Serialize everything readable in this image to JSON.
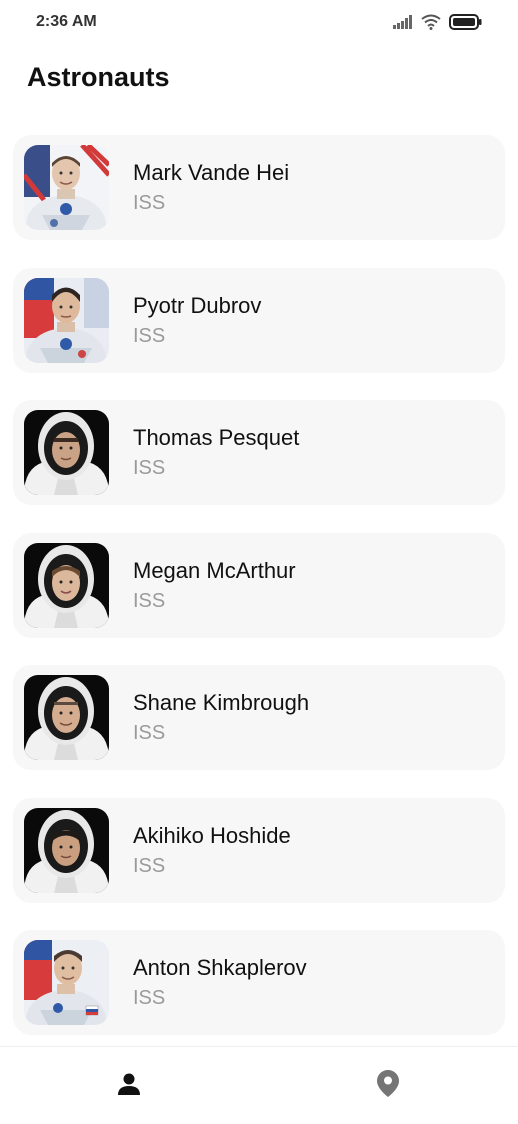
{
  "status_bar": {
    "time": "2:36 AM",
    "icons": [
      "signal-icon",
      "wifi-icon",
      "battery-icon"
    ]
  },
  "page": {
    "title": "Astronauts"
  },
  "astronauts": [
    {
      "name": "Mark Vande Hei",
      "craft": "ISS",
      "portrait": "soyuz-suit-us-flag"
    },
    {
      "name": "Pyotr Dubrov",
      "craft": "ISS",
      "portrait": "soyuz-suit-ru-flag"
    },
    {
      "name": "Thomas Pesquet",
      "craft": "ISS",
      "portrait": "spacex-suit-helmet"
    },
    {
      "name": "Megan McArthur",
      "craft": "ISS",
      "portrait": "spacex-suit-helmet"
    },
    {
      "name": "Shane Kimbrough",
      "craft": "ISS",
      "portrait": "spacex-suit-helmet"
    },
    {
      "name": "Akihiko Hoshide",
      "craft": "ISS",
      "portrait": "spacex-suit-helmet"
    },
    {
      "name": "Anton Shkaplerov",
      "craft": "ISS",
      "portrait": "soyuz-suit-ru-flag"
    }
  ],
  "bottom_nav": {
    "items": [
      {
        "icon": "person-icon",
        "active": true
      },
      {
        "icon": "location-pin-icon",
        "active": false
      }
    ]
  },
  "colors": {
    "card_background": "#f7f7f7",
    "secondary_text": "#9a9a9a",
    "nav_active": "#111111",
    "nav_inactive": "#757575"
  }
}
